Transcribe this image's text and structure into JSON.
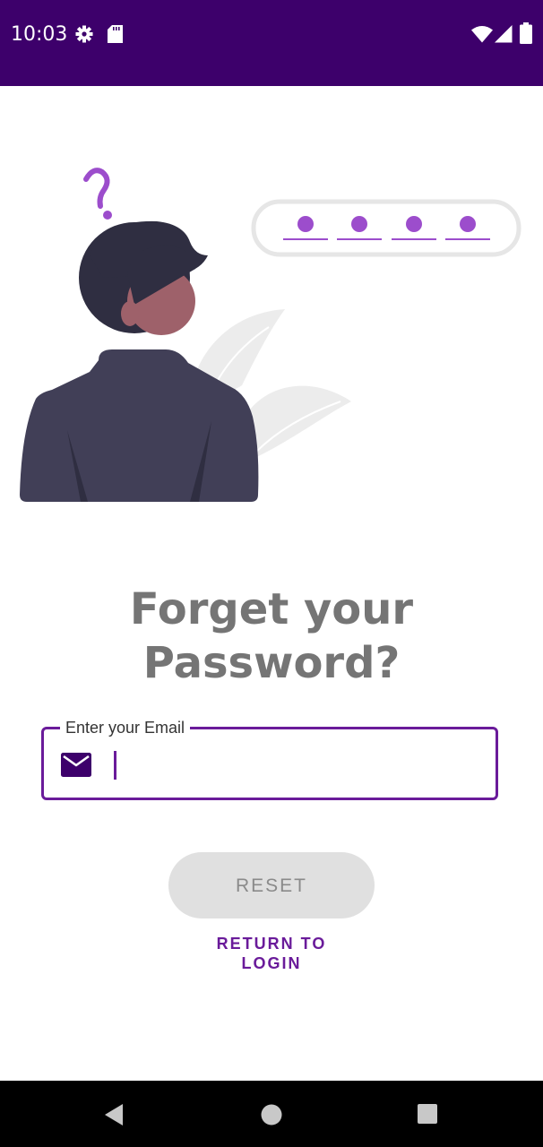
{
  "status_bar": {
    "time": "10:03",
    "icons": [
      "gear-icon",
      "sd-card-icon",
      "wifi-icon",
      "cell-signal-icon",
      "battery-icon"
    ],
    "background_color": "#3d006b"
  },
  "illustration": {
    "icons": [
      "person-icon",
      "question-mark-icon",
      "password-dots-icon",
      "leaf-icon"
    ],
    "accent_color": "#9c4dcc"
  },
  "title": {
    "line1": "Forget your",
    "line2": "Password?"
  },
  "email_field": {
    "label": "Enter your Email",
    "value": "",
    "placeholder": "",
    "icon": "mail-icon",
    "border_color": "#6a1b9a"
  },
  "reset_button": {
    "label": "RESET"
  },
  "return_link": {
    "line1": "RETURN TO",
    "line2": "LOGIN",
    "color": "#6a1b9a"
  },
  "nav_bar": {
    "icons": [
      "back-icon",
      "home-icon",
      "recents-icon"
    ]
  }
}
